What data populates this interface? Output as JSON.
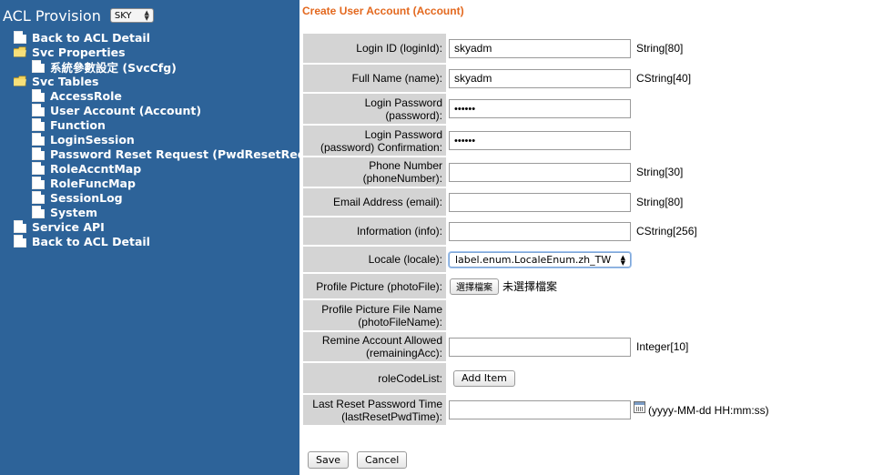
{
  "sidebar": {
    "title": "ACL Provision",
    "env_selected": "SKY",
    "items": [
      {
        "label": "Back to ACL Detail",
        "icon": "page-icon"
      },
      {
        "label": "Svc Properties",
        "icon": "folder-icon"
      },
      {
        "label": "系統參數設定 (SvcCfg)",
        "icon": "page-icon"
      },
      {
        "label": "Svc Tables",
        "icon": "folder-icon"
      },
      {
        "label": "AccessRole",
        "icon": "page-icon"
      },
      {
        "label": "User Account (Account)",
        "icon": "page-icon"
      },
      {
        "label": "Function",
        "icon": "page-icon"
      },
      {
        "label": "LoginSession",
        "icon": "page-icon"
      },
      {
        "label": "Password Reset Request (PwdResetReq)",
        "icon": "page-icon"
      },
      {
        "label": "RoleAccntMap",
        "icon": "page-icon"
      },
      {
        "label": "RoleFuncMap",
        "icon": "page-icon"
      },
      {
        "label": "SessionLog",
        "icon": "page-icon"
      },
      {
        "label": "System",
        "icon": "page-icon"
      },
      {
        "label": "Service API",
        "icon": "page-icon"
      },
      {
        "label": "Back to ACL Detail",
        "icon": "page-icon"
      }
    ]
  },
  "form": {
    "heading": "Create User Account (Account)",
    "fields": {
      "login_id": {
        "label": "Login ID (loginId):",
        "value": "skyadm",
        "type_hint": "String[80]"
      },
      "full_name": {
        "label": "Full Name (name):",
        "value": "skyadm",
        "type_hint": "CString[40]"
      },
      "password": {
        "label_line1": "Login Password",
        "label_line2": "(password):",
        "value": "••••••"
      },
      "password_confirm": {
        "label_line1": "Login Password",
        "label_line2": "(password) Confirmation:",
        "value": "••••••"
      },
      "phone": {
        "label_line1": "Phone Number",
        "label_line2": "(phoneNumber):",
        "value": "",
        "type_hint": "String[30]"
      },
      "email": {
        "label": "Email Address (email):",
        "value": "",
        "type_hint": "String[80]"
      },
      "info": {
        "label": "Information (info):",
        "value": "",
        "type_hint": "CString[256]"
      },
      "locale": {
        "label": "Locale (locale):",
        "selected": "label.enum.LocaleEnum.zh_TW"
      },
      "photo_file": {
        "label": "Profile Picture (photoFile):",
        "button": "選擇檔案",
        "file_name": "未選擇檔案"
      },
      "photo_file_name": {
        "label_line1": "Profile Picture File Name",
        "label_line2": "(photoFileName):"
      },
      "remaining_acc": {
        "label_line1": "Remine Account Allowed",
        "label_line2": "(remainingAcc):",
        "value": "",
        "type_hint": "Integer[10]"
      },
      "role_code_list": {
        "label": "roleCodeList:",
        "button": "Add Item"
      },
      "last_reset": {
        "label_line1": "Last Reset Password Time",
        "label_line2": "(lastResetPwdTime):",
        "value": "",
        "format_hint": "(yyyy-MM-dd HH:mm:ss)"
      }
    },
    "actions": {
      "save": "Save",
      "cancel": "Cancel"
    }
  },
  "colors": {
    "sidebar_bg": "#2d6399",
    "heading": "#e3681e",
    "label_bg": "#d4d4d4"
  }
}
